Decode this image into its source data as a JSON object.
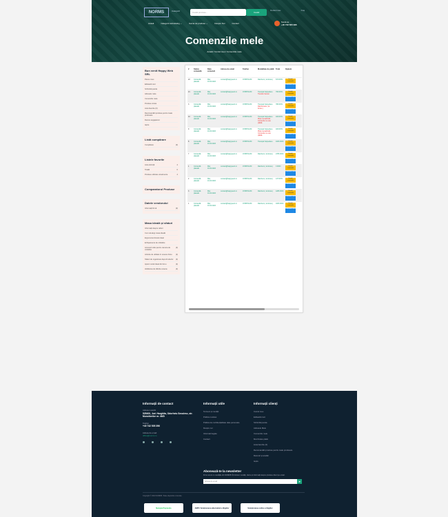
{
  "header": {
    "logo": "NORMS",
    "categories_label": "Categorii",
    "search_placeholder": "Caută produse...",
    "search_button": "Caută",
    "account_links": [
      "Contul meu",
      "Coș"
    ],
    "nav": [
      "Acasă",
      "Categorii subcatalog ⌄",
      "Gama de produse ⌄",
      "Despre Noi",
      "Contact"
    ],
    "phone_label": "Sună-ne",
    "phone": "+40 742 505 396",
    "page_title": "Comenzile mele",
    "breadcrumb": "Acasă  /  Contul meu  /  Comenzile mele"
  },
  "sidebar": {
    "welcome": "Bun venit Happy Web SRL",
    "account_items": [
      "Panou meu",
      "Editează cont",
      "Schimbă parola",
      "Adresele mele",
      "Comenzile mele",
      "Produse vizate",
      "Lista favorite (0)",
      "Recomandări produse pentru toate produsele",
      "Devino angajatorul",
      "Ieșire"
    ],
    "cart_title": "Listă cumpărare",
    "cart_items": [
      {
        "label": "Cumpărare",
        "count": "(0)"
      }
    ],
    "wish_title": "Listele favorite",
    "wish_items": [
      {
        "label": "Lista dorință",
        "count": "4"
      },
      {
        "label": "Totală",
        "count": "0"
      },
      {
        "label": "Produse utilizate uzualmente",
        "count": "4"
      }
    ],
    "compare_title": "Comparatorul Produse",
    "data_title": "Datele vendorului",
    "data_items": [
      {
        "label": "Informații firmă",
        "count": "(0)"
      }
    ],
    "tips_title": "Masa ideală și sfaturi",
    "tips_items": [
      {
        "label": "Informații despre rafturi",
        "count": ""
      },
      {
        "label": "Cum să alegi masa ideală",
        "count": ""
      },
      {
        "label": "Ergonomia biroului ideal",
        "count": ""
      },
      {
        "label": "Echipamente de cofetărie",
        "count": ""
      },
      {
        "label": "Accesorii utile pentru camera de cofetărie",
        "count": "(4)"
      },
      {
        "label": "Articole de utilitate în scaune birou",
        "count": "(2)"
      },
      {
        "label": "Sfaturi de organizare depozit efectiv",
        "count": "(4)"
      },
      {
        "label": "Ajutor modul ideal din birou",
        "count": "(2)"
      },
      {
        "label": "Alcătuirea de diferite scaune",
        "count": "(4)"
      }
    ]
  },
  "table": {
    "headers": [
      "#",
      "Status comandă",
      "Data comenzii",
      "Adresa de email",
      "Telefon",
      "Modalitate de plată",
      "Total",
      "Opțiuni"
    ],
    "btn_view": "Detalii comanda",
    "btn_pay": "Comanda nouă",
    "rows": [
      {
        "id": "22",
        "status": "Comandă plasată",
        "date": "Mar, 16.04.2024",
        "email": "contact@happyweb.ro",
        "phone": "0748571230",
        "pay": "Ramburs ( la livrare)",
        "note": "",
        "total": "672 RON"
      },
      {
        "id": "21",
        "status": "Comandă plasată",
        "date": "Mar, 16.04.2024",
        "email": "contact@happyweb.ro",
        "phone": "0748571230",
        "pay": "Transport Expediere",
        "note": "Transfer bancar",
        "total": "760 RON"
      },
      {
        "id": "3",
        "status": "Comandă plasată",
        "date": "Mar, 16.04.2024",
        "email": "contact@happyweb.ro",
        "phone": "0748571230",
        "pay": "Transport Expediere",
        "note": "Rambursare ( la livrare )",
        "total": "780 RON"
      },
      {
        "id": "10",
        "status": "Comandă plasată",
        "date": "Mar, 16.04.2024",
        "email": "contact@happyweb.ro",
        "phone": "0748571230",
        "pay": "Transport Expediere",
        "note": "Plata nerealizată - Comanda nu este plătită",
        "total": "184 RON"
      },
      {
        "id": "9",
        "status": "Comandă plasată",
        "date": "Mar, 16.04.2024",
        "email": "contact@happyweb.ro",
        "phone": "0748571230",
        "pay": "Transport Expediere",
        "note": "Plata nerealizată - Comanda nu este plătită",
        "total": "184 RON"
      },
      {
        "id": "8",
        "status": "Comandă plasată",
        "date": "Mar, 16.04.2024",
        "email": "contact@happyweb.ro",
        "phone": "0748571230",
        "pay": "Transport Expediere",
        "note": "",
        "total": "1006 RON"
      },
      {
        "id": "7",
        "status": "Comandă plasată",
        "date": "Mar, 16.04.2024",
        "email": "contact@happyweb.ro",
        "phone": "0748571230",
        "pay": "Ramburs ( la livrare)",
        "note": "",
        "total": "2786 RON"
      },
      {
        "id": "1",
        "status": "Comandă plasată",
        "date": "Mar, 16.04.2024",
        "email": "contact@happyweb.ro",
        "phone": "0748571230",
        "pay": "Ramburs ( la livrare)",
        "note": "",
        "total": "3 RON"
      },
      {
        "id": "2",
        "status": "Comandă plasată",
        "date": "Mar, 16.04.2024",
        "email": "contact@happyweb.ro",
        "phone": "0748571230",
        "pay": "Ramburs ( la livrare)",
        "note": "",
        "total": "137 RON"
      },
      {
        "id": "3",
        "status": "Comandă plasată",
        "date": "Mar, 16.04.2024",
        "email": "contact@happyweb.ro",
        "phone": "0748571230",
        "pay": "Ramburs ( la livrare)",
        "note": "",
        "total": "1286 RON"
      },
      {
        "id": "1",
        "status": "Comandă plasată",
        "date": "Mar, 16.04.2024",
        "email": "contact@happyweb.ro",
        "phone": "0748571230",
        "pay": "Ramburs ( la livrare)",
        "note": "",
        "total": "1006 RON"
      }
    ]
  },
  "footer": {
    "contact_title": "Informații de contact",
    "address_label": "Adresa noastră",
    "address": "525400, Jud. Harghita, Odorheiu Secuiesc, str. Muncitorilor nr. 46/D",
    "phone_label": "Telefon",
    "phone": "+40 742 505 396",
    "email_label": "Adresa de email",
    "email": "office@norms.ro",
    "utile_title": "Informații utile",
    "utile_links": [
      "Termeni și condiții",
      "Politica cookies",
      "Politica de confidențialitate date personale",
      "Despre noi",
      "Informatii legale",
      "Contact"
    ],
    "client_title": "Informații clienți",
    "client_links": [
      "Contul meu",
      "Editează cont",
      "Schimbă parola",
      "Adresele Mele",
      "Comenzile mele",
      "Mod livrare plată",
      "Lista favorite (0)",
      "Recomandări produse pentru toate produsele",
      "Retururi și anulări",
      "Ieșire"
    ],
    "newsletter_title": "Abonează-te la newsletter",
    "newsletter_text": "Fii la curent cu noutățile din NORMS! Îți trimitem noutăți, oferte și informații despre produse direct pe email.",
    "newsletter_placeholder": "Adresa de email",
    "copyright": "Copyright © 2024 NORMS. Toate drepturile rezervate.",
    "badges": [
      "Netopia Payments",
      "ANPC Soluționarea alternativă a litigiilor",
      "Soluționarea online a litigiilor"
    ]
  }
}
